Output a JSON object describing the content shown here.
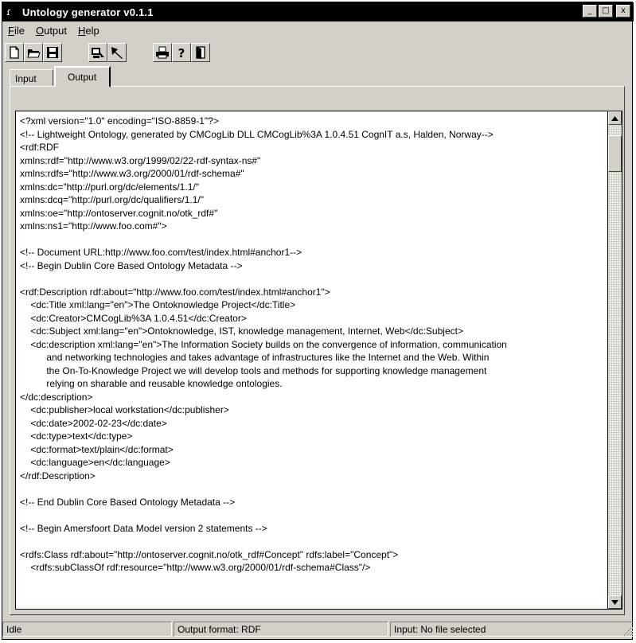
{
  "window": {
    "title": "Untology generator v0.1.1",
    "app_icon": "feather-icon"
  },
  "window_controls": {
    "minimize": "_",
    "maximize": "□",
    "close": "x"
  },
  "menu": [
    {
      "prefix": "",
      "underline": "F",
      "rest": "ile"
    },
    {
      "prefix": "",
      "underline": "O",
      "rest": "utput"
    },
    {
      "prefix": "",
      "underline": "H",
      "rest": "elp"
    }
  ],
  "toolbar": [
    "new-file-icon",
    "open-folder-icon",
    "save-disk-icon",
    "generate-icon",
    "run-icon",
    "print-icon",
    "help-icon",
    "exit-door-icon"
  ],
  "tabs": {
    "input": "Input",
    "output": "Output"
  },
  "output_text": [
    "<?xml version=\"1.0\" encoding=\"ISO-8859-1\"?>",
    "<!-- Lightweight Ontology, generated by CMCogLib DLL CMCogLib%3A 1.0.4.51 CognIT a.s, Halden, Norway-->",
    "<rdf:RDF",
    "xmlns:rdf=\"http://www.w3.org/1999/02/22-rdf-syntax-ns#\"",
    "xmlns:rdfs=\"http://www.w3.org/2000/01/rdf-schema#\"",
    "xmlns:dc=\"http://purl.org/dc/elements/1.1/\"",
    "xmlns:dcq=\"http://purl.org/dc/qualifiers/1.1/\"",
    "xmlns:oe=\"http://ontoserver.cognit.no/otk_rdf#\"",
    "xmlns:ns1=\"http://www.foo.com#\">",
    "",
    "<!-- Document URL:http://www.foo.com/test/index.html#anchor1-->",
    "<!-- Begin Dublin Core Based Ontology Metadata -->",
    "",
    "<rdf:Description rdf:about=\"http://www.foo.com/test/index.html#anchor1\">",
    "    <dc:Title xml:lang=\"en\">The Ontoknowledge Project</dc:Title>",
    "    <dc:Creator>CMCogLib%3A 1.0.4.51</dc:Creator>",
    "    <dc:Subject xml:lang=\"en\">Ontoknowledge, IST, knowledge management, Internet, Web</dc:Subject>",
    "    <dc:description xml:lang=\"en\">The Information Society builds on the convergence of information, communication",
    "          and networking technologies and takes advantage of infrastructures like the Internet and the Web. Within",
    "          the On-To-Knowledge Project we will develop tools and methods for supporting knowledge management",
    "          relying on sharable and reusable knowledge ontologies.",
    "</dc:description>",
    "    <dc:publisher>local workstation</dc:publisher>",
    "    <dc:date>2002-02-23</dc:date>",
    "    <dc:type>text</dc:type>",
    "    <dc:format>text/plain</dc:format>",
    "    <dc:language>en</dc:language>",
    "</rdf:Description>",
    "",
    "<!-- End Dublin Core Based Ontology Metadata -->",
    "",
    "<!-- Begin Amersfoort Data Model version 2 statements -->",
    "",
    "<rdfs:Class rdf:about=\"http://ontoserver.cognit.no/otk_rdf#Concept\" rdfs:label=\"Concept\">",
    "    <rdfs:subClassOf rdf:resource=\"http://www.w3.org/2000/01/rdf-schema#Class\"/>"
  ],
  "status": {
    "state": "Idle",
    "format": "Output format: RDF",
    "input": "Input: No file selected"
  }
}
